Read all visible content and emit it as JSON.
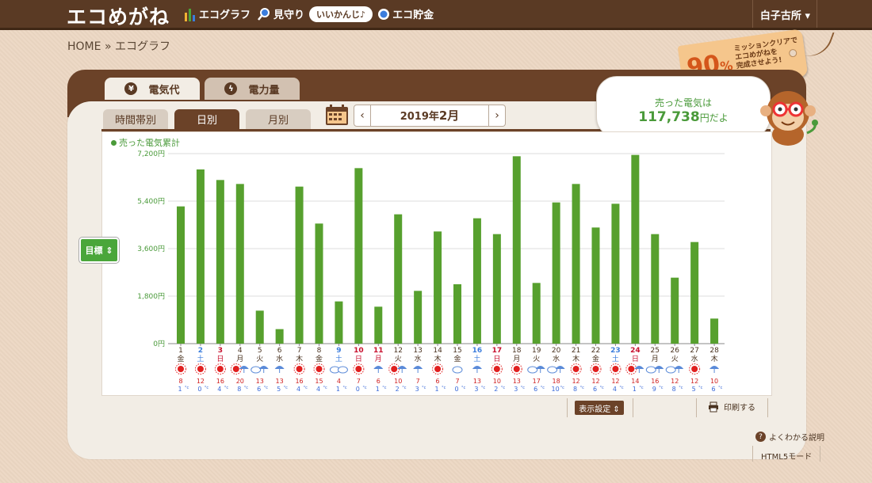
{
  "header": {
    "logo": "エコめがね",
    "nav": [
      {
        "label": "エコグラフ",
        "icon": "bar-chart-icon"
      },
      {
        "label": "見守り",
        "icon": "magnifier-icon"
      },
      {
        "label": "エコ貯金",
        "icon": "coin-icon"
      }
    ],
    "bubble": "いいかんじ♪",
    "user": "白子古所"
  },
  "breadcrumb": {
    "home": "HOME",
    "sep": "»",
    "current": "エコグラフ"
  },
  "tag": {
    "percent": "90",
    "unit": "%",
    "message": [
      "ミッションクリアで",
      "エコめがねを",
      "完成させよう!"
    ]
  },
  "tabs": {
    "primary": [
      {
        "label": "電気代",
        "icon": "yen-icon",
        "active": true
      },
      {
        "label": "電力量",
        "icon": "lightning-icon",
        "active": false
      }
    ],
    "secondary": [
      {
        "label": "時間帯別",
        "active": false
      },
      {
        "label": "日別",
        "active": true
      },
      {
        "label": "月別",
        "active": false
      }
    ]
  },
  "date": {
    "prev": "‹",
    "next": "›",
    "year": "2019年",
    "month": "2月"
  },
  "speech": {
    "line1": "売った電気は",
    "amount": "117,738",
    "suffix": "円だよ"
  },
  "goal_button": "目標 ⇕",
  "colors": {
    "bar": "#57a02e",
    "holiday": "#c8102e",
    "saturday": "#3b7ddd",
    "brown": "#6b4228"
  },
  "chart_data": {
    "type": "bar",
    "legend": "売った電気累計",
    "ylim": [
      0,
      7200
    ],
    "yticks": [
      "0円",
      "1,800円",
      "3,600円",
      "5,400円",
      "7,200円"
    ],
    "categories": [
      "1",
      "2",
      "3",
      "4",
      "5",
      "6",
      "7",
      "8",
      "9",
      "10",
      "11",
      "12",
      "13",
      "14",
      "15",
      "16",
      "17",
      "18",
      "19",
      "20",
      "21",
      "22",
      "23",
      "24",
      "25",
      "26",
      "27",
      "28"
    ],
    "weekday": [
      "金",
      "土",
      "日",
      "月",
      "火",
      "水",
      "木",
      "金",
      "土",
      "日",
      "月",
      "火",
      "水",
      "木",
      "金",
      "土",
      "日",
      "月",
      "火",
      "水",
      "木",
      "金",
      "土",
      "日",
      "月",
      "火",
      "水",
      "木"
    ],
    "daytype": [
      "w",
      "sat",
      "hol",
      "w",
      "w",
      "w",
      "w",
      "w",
      "sat",
      "hol",
      "hol",
      "w",
      "w",
      "w",
      "w",
      "sat",
      "hol",
      "w",
      "w",
      "w",
      "w",
      "w",
      "sat",
      "hol",
      "w",
      "w",
      "w",
      "w"
    ],
    "values": [
      5200,
      6600,
      6200,
      6050,
      1250,
      550,
      5950,
      4550,
      1600,
      6650,
      1400,
      4900,
      2000,
      4250,
      2250,
      4750,
      4150,
      7100,
      2300,
      5350,
      6050,
      4400,
      5300,
      7150,
      4150,
      2500,
      3850,
      950
    ],
    "weather": [
      "sun",
      "sun",
      "sun",
      "sun-umbrella",
      "cloud-umbrella",
      "umbrella",
      "sun",
      "sun",
      "cloud-cloud",
      "sun",
      "umbrella",
      "sun-umbrella",
      "umbrella",
      "sun",
      "cloud",
      "umbrella",
      "sun",
      "sun",
      "cloud-umbrella",
      "cloud-umbrella",
      "sun",
      "sun",
      "sun",
      "sun-umbrella",
      "cloud-umbrella",
      "cloud-umbrella",
      "sun",
      "umbrella"
    ],
    "temp_high": [
      "8",
      "12",
      "16",
      "20",
      "13",
      "13",
      "16",
      "15",
      "4",
      "7",
      "6",
      "10",
      "7",
      "6",
      "7",
      "13",
      "10",
      "13",
      "17",
      "18",
      "12",
      "12",
      "12",
      "14",
      "16",
      "12",
      "12",
      "10"
    ],
    "temp_low": [
      "1",
      "0",
      "4",
      "8",
      "6",
      "5",
      "4",
      "4",
      "1",
      "0",
      "1",
      "2",
      "3",
      "1",
      "0",
      "3",
      "2",
      "3",
      "6",
      "10",
      "8",
      "6",
      "4",
      "1",
      "9",
      "8",
      "5",
      "6"
    ]
  },
  "footer": {
    "settings": "表示設定 ⇕",
    "print": "印刷する",
    "help": "よくわかる説明",
    "html5": "HTML5モード"
  }
}
